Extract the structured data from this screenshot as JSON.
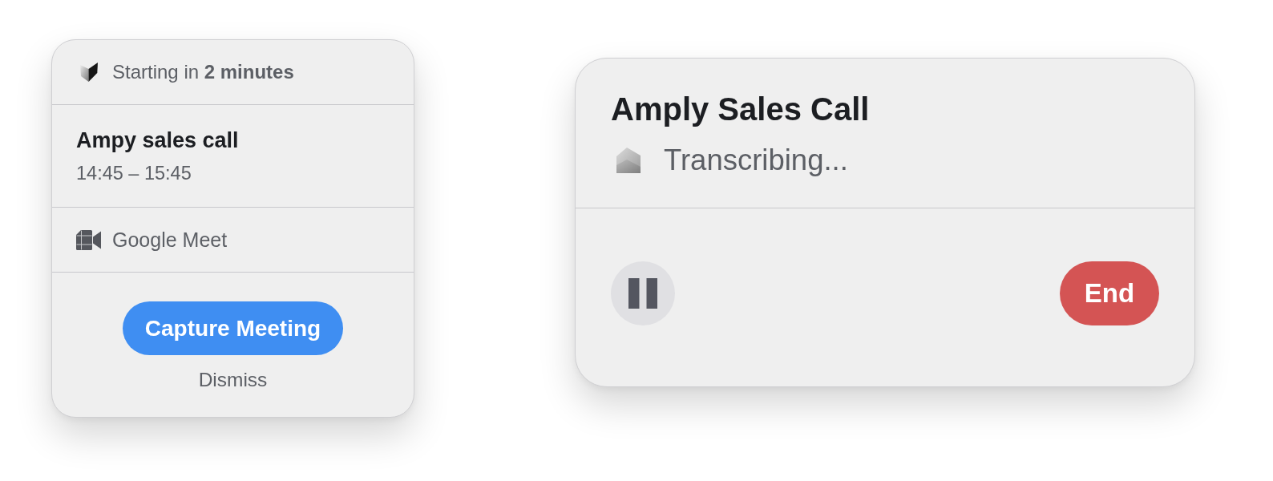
{
  "upcoming_card": {
    "header": {
      "text": "Starting in **2 minutes**"
    },
    "meeting": {
      "title": "Ampy sales call",
      "time": "14:45 – 15:45"
    },
    "platform": {
      "name": "Google Meet"
    },
    "actions": [
      {
        "kind": "primary",
        "label": "Capture Meeting"
      },
      {
        "kind": "link",
        "label": "Dismiss"
      }
    ]
  },
  "recording_card": {
    "title": "Amply Sales Call",
    "status": "Transcribing...",
    "controls": [
      {
        "kind": "pause"
      },
      {
        "kind": "end",
        "label": "End"
      }
    ]
  }
}
